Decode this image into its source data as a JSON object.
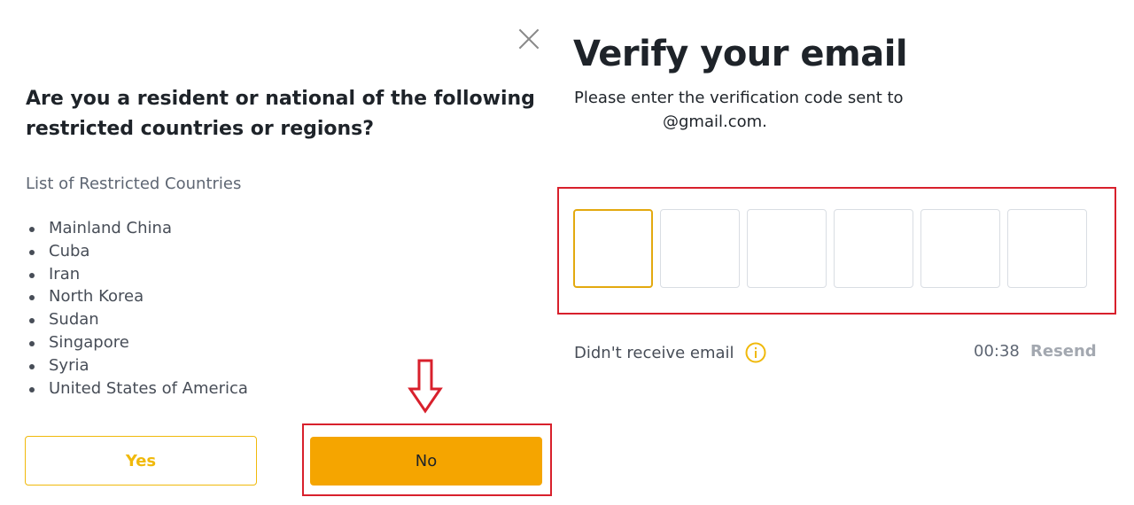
{
  "left_dialog": {
    "question": "Are you a resident or national of the following restricted countries or regions?",
    "list_title": "List of Restricted Countries",
    "countries": [
      "Mainland China",
      "Cuba",
      "Iran",
      "North Korea",
      "Sudan",
      "Singapore",
      "Syria",
      "United States of America"
    ],
    "yes_label": "Yes",
    "no_label": "No"
  },
  "right_dialog": {
    "title": "Verify your email",
    "subtitle_line1": "Please enter the verification code sent to",
    "subtitle_line2": "@gmail.com.",
    "code_digits": [
      "",
      "",
      "",
      "",
      "",
      ""
    ],
    "didnt_receive": "Didn't receive email",
    "timer": "00:38",
    "resend_label": "Resend"
  },
  "colors": {
    "accent": "#f0b90b",
    "button_fill": "#f5a500",
    "highlight_red": "#d8202c",
    "text": "#1e2329",
    "muted": "#a3a8b0"
  },
  "icons": {
    "close": "close-icon",
    "info": "info-icon",
    "arrow": "down-arrow-annotation"
  }
}
